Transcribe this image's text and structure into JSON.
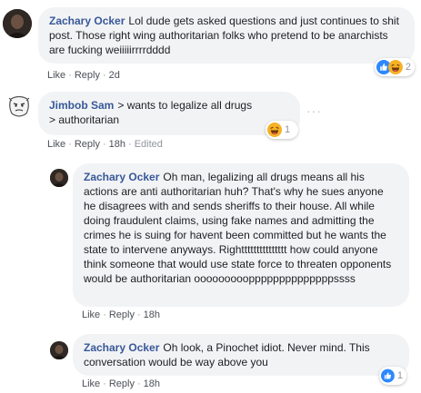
{
  "comments": [
    {
      "author": "Zachary Ocker",
      "text": "Lol dude gets asked questions and just continues to shit post. Those right wing authoritarian folks who pretend to be anarchists are fucking weiiiiirrrrdddd",
      "actions": {
        "like": "Like",
        "reply": "Reply",
        "time": "2d"
      },
      "reactions": {
        "types": [
          "like-icon",
          "haha-icon"
        ],
        "count": "2"
      }
    },
    {
      "author": "Jimbob Sam",
      "text": "> wants to legalize all drugs\n> authoritarian",
      "actions": {
        "like": "Like",
        "reply": "Reply",
        "time": "18h",
        "edited": "Edited"
      },
      "reactions": {
        "types": [
          "haha-icon"
        ],
        "count": "1"
      },
      "more": "···"
    },
    {
      "author": "Zachary Ocker",
      "text": "Oh man, legalizing all drugs means all his actions are anti authoritarian huh? That's why he sues anyone he disagrees with and sends sheriffs to their house. All while doing fraudulent claims, using fake names and admitting the crimes he is suing for havent been committed but he wants the state to intervene anyways. Righttttttttttttttt how could anyone think someone that would use state force to threaten opponents would be authoritarian oooooooooppppppppppppppssss",
      "actions": {
        "like": "Like",
        "reply": "Reply",
        "time": "18h"
      }
    },
    {
      "author": "Zachary Ocker",
      "text": "Oh look, a Pinochet idiot. Never mind. This conversation would be way above you",
      "actions": {
        "like": "Like",
        "reply": "Reply",
        "time": "18h"
      },
      "reactions": {
        "types": [
          "like-icon"
        ],
        "count": "1"
      }
    }
  ],
  "colors": {
    "name": "#385898",
    "bubble": "#f2f3f5",
    "like": "#2d88ff",
    "haha": "#f7b125"
  }
}
